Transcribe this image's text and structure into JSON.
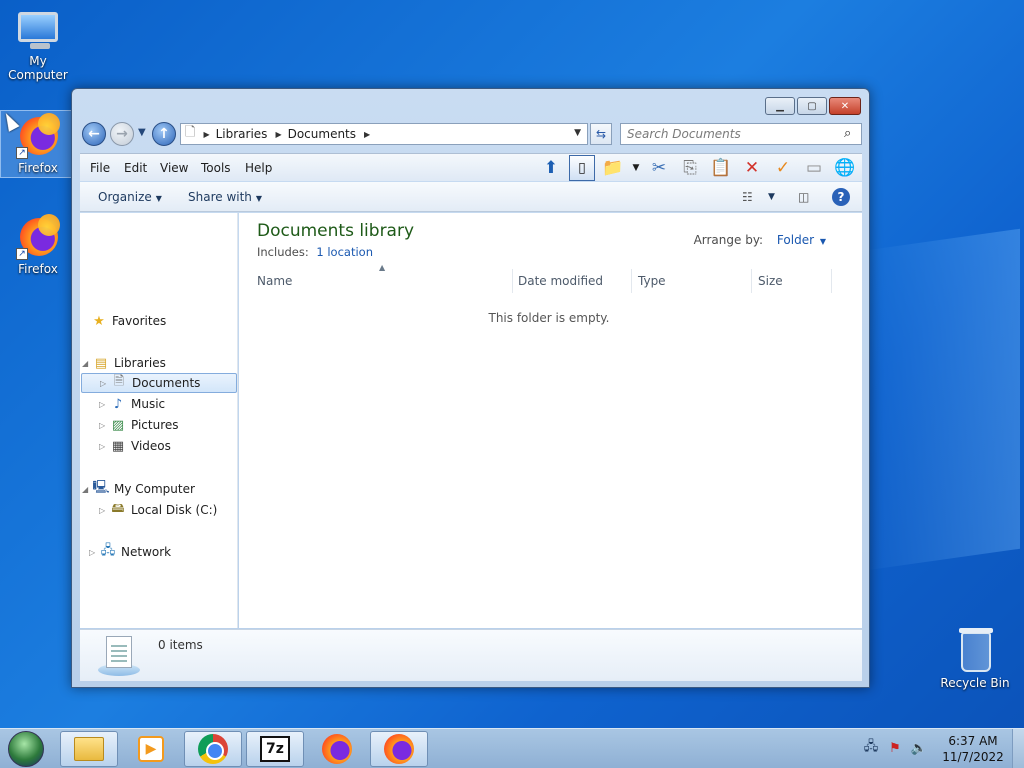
{
  "desktop": {
    "icons": [
      {
        "label": "My Computer",
        "icon": "monitor-icon"
      },
      {
        "label": "Firefox",
        "icon": "firefox-icon",
        "selected": true
      },
      {
        "label": "Firefox",
        "icon": "firefox-icon"
      },
      {
        "label": "Recycle Bin",
        "icon": "recycle-bin-icon"
      }
    ]
  },
  "window": {
    "caption_buttons": {
      "minimize": "▁",
      "maximize": "▢",
      "close": "✕"
    },
    "address": {
      "segments": [
        "Libraries",
        "Documents"
      ],
      "refresh_glyph": "⇆"
    },
    "search": {
      "placeholder": "Search Documents"
    },
    "menu": [
      "File",
      "Edit",
      "View",
      "Tools",
      "Help"
    ],
    "commands": {
      "organize": "Organize",
      "share_with": "Share with"
    },
    "nav_pane": {
      "favorites": "Favorites",
      "libraries": "Libraries",
      "library_items": [
        "Documents",
        "Music",
        "Pictures",
        "Videos"
      ],
      "computer": "My Computer",
      "computer_items": [
        "Local Disk (C:)"
      ],
      "network": "Network"
    },
    "content": {
      "title": "Documents library",
      "includes_label": "Includes:",
      "includes_link": "1 location",
      "arrange_label": "Arrange by:",
      "arrange_value": "Folder",
      "columns": [
        "Name",
        "Date modified",
        "Type",
        "Size"
      ],
      "empty_message": "This folder is empty."
    },
    "details": {
      "items_count": "0 items"
    }
  },
  "taskbar": {
    "apps": [
      "windows-explorer",
      "media-player",
      "chrome",
      "7zip",
      "firefox",
      "firefox"
    ],
    "clock_time": "6:37 AM",
    "clock_date": "11/7/2022",
    "sevenzip_label": "7z"
  },
  "colors": {
    "desktop_blue": "#1c7ee0",
    "library_title_green": "#1e5a18",
    "link_blue": "#1a58b0"
  }
}
